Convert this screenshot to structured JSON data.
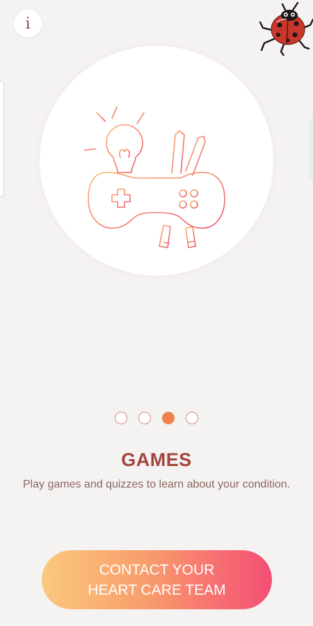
{
  "info_button": {
    "label": "i",
    "icon": "info-icon"
  },
  "mascot": {
    "icon": "ladybug-icon"
  },
  "hero": {
    "icon": "games-illustration-icon",
    "accent_start": "#f9a66b",
    "accent_end": "#f0506e"
  },
  "pager": {
    "count": 4,
    "active_index": 2
  },
  "slide": {
    "title": "GAMES",
    "description": "Play games and quizzes to learn about your condition."
  },
  "cta": {
    "label": "CONTACT YOUR\nHEART CARE TEAM",
    "gradient": [
      "#fbc87e",
      "#f76a72",
      "#f44e74"
    ]
  }
}
